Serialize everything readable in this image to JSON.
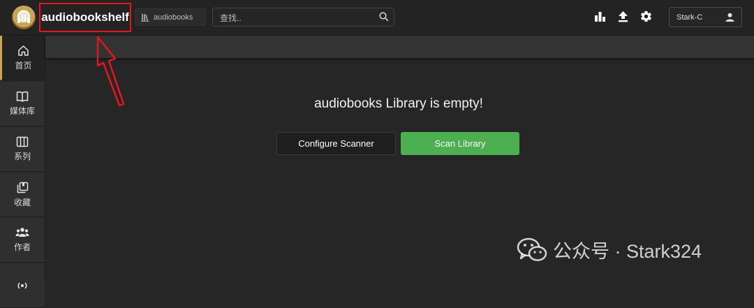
{
  "header": {
    "app_title": "audiobookshelf",
    "library_select": "audiobooks",
    "search_placeholder": "查找..",
    "user_name": "Stark-C"
  },
  "sidebar": {
    "items": [
      {
        "label": "首页",
        "icon": "home-icon",
        "active": true
      },
      {
        "label": "媒体库",
        "icon": "book-open-icon"
      },
      {
        "label": "系列",
        "icon": "columns-icon"
      },
      {
        "label": "收藏",
        "icon": "collection-icon"
      },
      {
        "label": "作者",
        "icon": "people-icon"
      }
    ]
  },
  "main": {
    "empty_message": "audiobooks Library is empty!",
    "configure_button": "Configure Scanner",
    "scan_button": "Scan Library"
  },
  "watermark": {
    "text": "公众号 · Stark324"
  },
  "colors": {
    "accent_green": "#4caf50",
    "highlight_red": "#e4161f",
    "active_indicator": "#c9a64a"
  }
}
